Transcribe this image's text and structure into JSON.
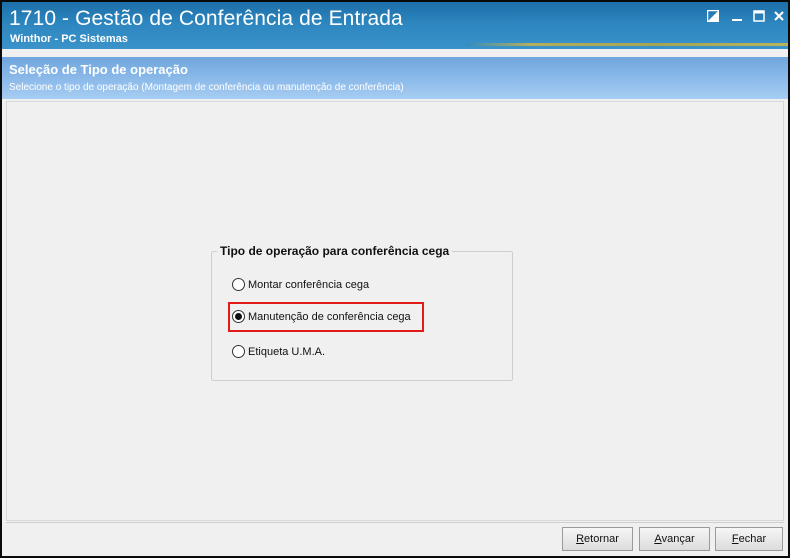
{
  "window": {
    "title": "1710 - Gestão de Conferência de Entrada",
    "subtitle": "Winthor - PC Sistemas"
  },
  "header": {
    "title": "Seleção de Tipo de operação",
    "description": "Selecione o tipo de operação (Montagem de conferência ou manutenção de conferência)"
  },
  "group": {
    "legend": "Tipo de operação para conferência cega",
    "options": [
      {
        "label": "Montar conferência cega",
        "selected": false
      },
      {
        "label": "Manutenção de conferência cega",
        "selected": true
      },
      {
        "label": "Etiqueta U.M.A.",
        "selected": false
      }
    ]
  },
  "footer": {
    "retornar": {
      "mnemonic": "R",
      "rest": "etornar"
    },
    "avancar": {
      "mnemonic": "A",
      "rest": "vançar"
    },
    "fechar": {
      "mnemonic": "F",
      "rest": "echar"
    }
  },
  "colors": {
    "titlebar": "#2d86bf",
    "header": "#8dbbea",
    "highlight": "#e21a1a"
  },
  "icons": [
    "restore-icon",
    "minimize-icon",
    "maximize-icon",
    "close-icon"
  ]
}
